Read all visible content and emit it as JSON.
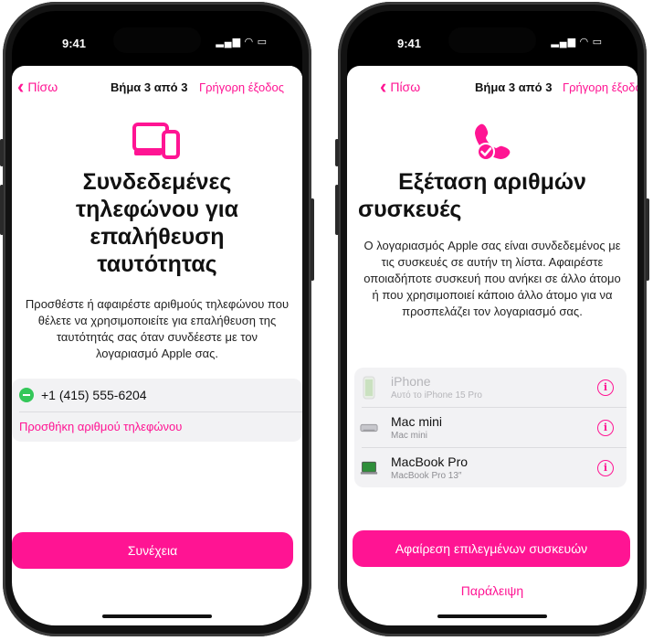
{
  "left": {
    "status_time": "9:41",
    "status_icons": "▂▄▆ ◠ ▭",
    "back_label": "Πίσω",
    "step_label": "Βήμα 3 από 3",
    "exit_label": "Γρήγορη έξοδος",
    "title_line1": "Συνδεδεμένες",
    "title_line2": "τηλεφώνου για",
    "title_line3": "επαλήθευση",
    "title_line4": "ταυτότητας",
    "description": "Προσθέστε ή αφαιρέστε αριθμούς τηλεφώνου που θέλετε να χρησιμοποιείτε για επαλήθευση της ταυτότητάς σας όταν συνδέεστε με τον λογαριασμό Apple σας.",
    "phone_number": "+1 (415) 555-6204",
    "add_phone_label": "Προσθήκη αριθμού τηλεφώνου",
    "continue_label": "Συνέχεια",
    "accent_color": "#ff1493"
  },
  "right": {
    "status_time": "9:41",
    "status_icons": "▂▄▆ ◠ ▭",
    "back_label": "Πίσω",
    "step_label": "Βήμα 3 από 3",
    "exit_label": "Γρήγορη έξοδος",
    "title_line1": "Εξέταση αριθμών",
    "title_line2": "συσκευές",
    "description": "Ο λογαριασμός Apple σας είναι συνδεδεμένος με τις συσκευές σε αυτήν τη λίστα. Αφαιρέστε οποιαδήποτε συσκευή που ανήκει σε άλλο άτομο ή που χρησιμοποιεί κάποιο άλλο άτομο για να προσπελάζει τον λογαριασμό σας.",
    "devices": [
      {
        "name": "iPhone",
        "sub": "Αυτό το iPhone 15 Pro",
        "icon": "iphone-icon",
        "dimmed": true
      },
      {
        "name": "Mac mini",
        "sub": "Mac mini",
        "icon": "mac-mini-icon",
        "dimmed": false
      },
      {
        "name": "MacBook Pro",
        "sub": "MacBook Pro 13″",
        "icon": "macbook-icon",
        "dimmed": false
      }
    ],
    "remove_label": "Αφαίρεση επιλεγμένων συσκευών",
    "skip_label": "Παράλειψη",
    "accent_color": "#ff1493"
  }
}
